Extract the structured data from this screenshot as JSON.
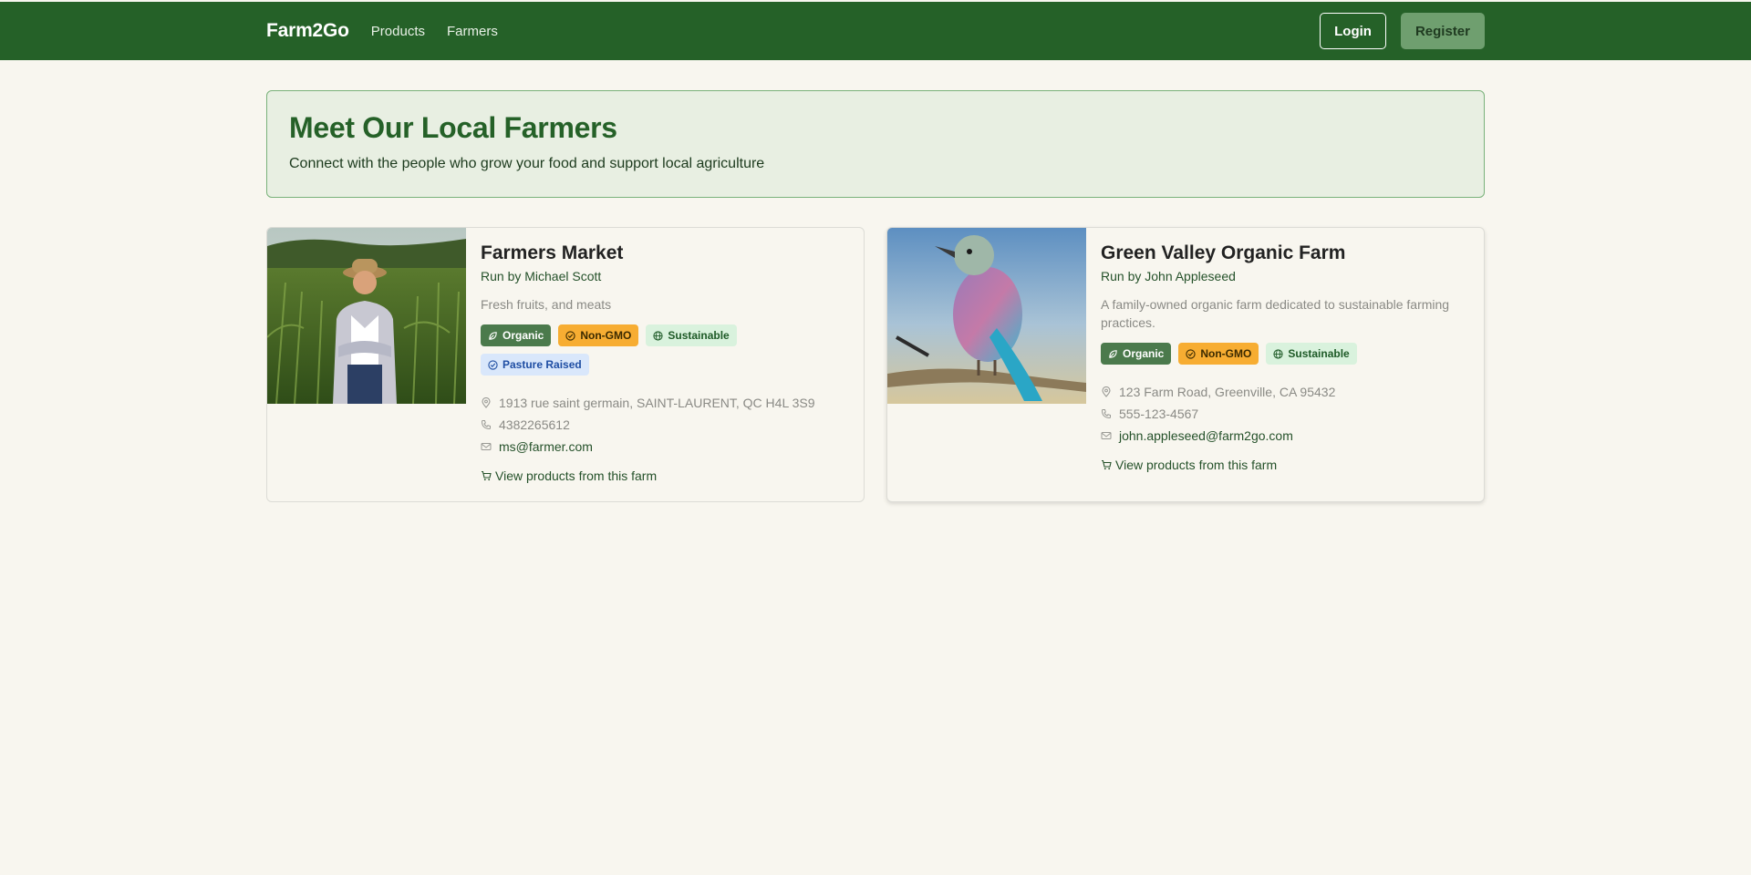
{
  "nav": {
    "brand": "Farm2Go",
    "links": [
      "Products",
      "Farmers"
    ],
    "login_label": "Login",
    "register_label": "Register"
  },
  "hero": {
    "title": "Meet Our Local Farmers",
    "subtitle": "Connect with the people who grow your food and support local agriculture"
  },
  "farms": [
    {
      "name": "Farmers Market",
      "owner": "Run by Michael Scott",
      "description": "Fresh fruits, and meats",
      "tags": [
        "Organic",
        "Non-GMO",
        "Sustainable",
        "Pasture Raised"
      ],
      "address": "1913 rue saint germain, SAINT-LAURENT, QC H4L 3S9",
      "phone": "4382265612",
      "email": "ms@farmer.com",
      "link_label": "View products from this farm"
    },
    {
      "name": "Green Valley Organic Farm",
      "owner": "Run by John Appleseed",
      "description": "A family-owned organic farm dedicated to sustainable farming practices.",
      "tags": [
        "Organic",
        "Non-GMO",
        "Sustainable"
      ],
      "address": "123 Farm Road, Greenville, CA 95432",
      "phone": "555-123-4567",
      "email": "john.appleseed@farm2go.com",
      "link_label": "View products from this farm"
    }
  ],
  "colors": {
    "brand_green": "#256128",
    "page_bg": "#f8f6ef",
    "tag_organic": "#4b7a4c",
    "tag_nongmo": "#f7ad32",
    "tag_sustainable": "#d9f2dd",
    "tag_pasture": "#d9e7fb"
  },
  "icons": {
    "organic": "leaf-icon",
    "nongmo": "check-circle-icon",
    "sustainable": "globe-icon",
    "pasture": "badge-check-icon",
    "address": "map-pin-icon",
    "phone": "phone-icon",
    "email": "mail-icon",
    "link": "cart-icon"
  }
}
